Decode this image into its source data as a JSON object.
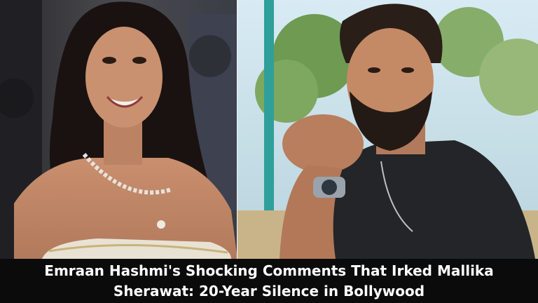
{
  "headline": "Emraan Hashmi's Shocking Comments That Irked Mallika Sherawat: 20-Year Silence in Bollywood",
  "images": {
    "left_photo": "woman-red-carpet-portrait",
    "right_photo": "bearded-man-portrait"
  },
  "colors": {
    "caption_background": "#0b0b0b",
    "caption_text": "#ffffff",
    "divider": "#f4f4f4"
  }
}
